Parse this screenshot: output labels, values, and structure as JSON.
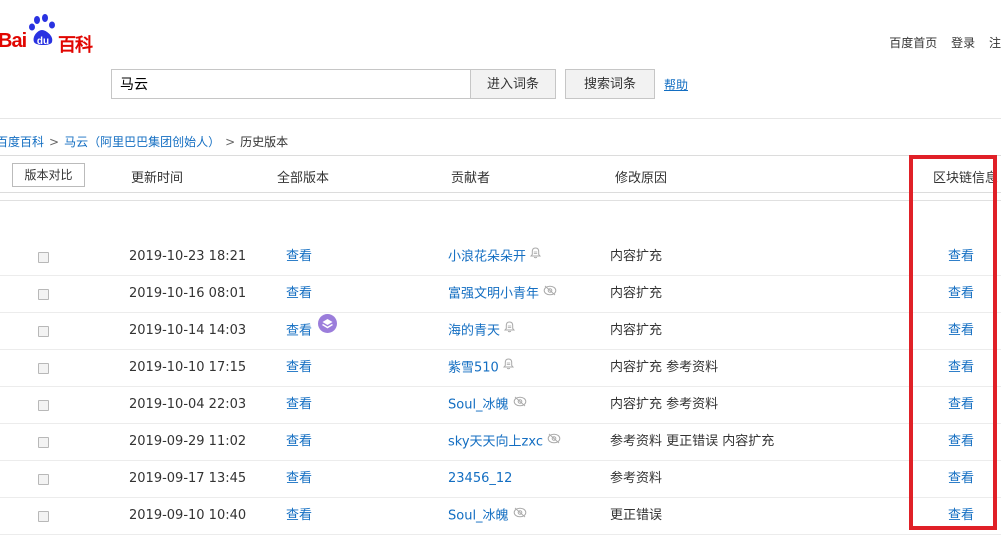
{
  "logo": {
    "bai": "Bai",
    "du": "du",
    "baike": "百科"
  },
  "top_links": [
    "百度首页",
    "登录",
    "注"
  ],
  "search": {
    "value": "马云",
    "enter_label": "进入词条",
    "search_label": "搜索词条",
    "help_label": "帮助"
  },
  "breadcrumb": {
    "home": "百度百科",
    "entry": "马云（阿里巴巴集团创始人）",
    "current": "历史版本",
    "separator": ">"
  },
  "table": {
    "compare_label": "版本对比",
    "columns": {
      "time": "更新时间",
      "all_versions": "全部版本",
      "contributor": "贡献者",
      "reason": "修改原因",
      "chain": "区块链信息"
    },
    "rows": [
      {
        "time": "2019-10-23 18:21",
        "view": "查看",
        "contributor": "小浪花朵朵开",
        "icon": "bell-icon",
        "reason": "内容扩充",
        "chain": "查看",
        "featured": false
      },
      {
        "time": "2019-10-16 08:01",
        "view": "查看",
        "contributor": "富强文明小青年",
        "icon": "eye-icon",
        "reason": "内容扩充",
        "chain": "查看",
        "featured": false
      },
      {
        "time": "2019-10-14 14:03",
        "view": "查看",
        "contributor": "海的青天",
        "icon": "bell-icon",
        "reason": "内容扩充",
        "chain": "查看",
        "featured": true
      },
      {
        "time": "2019-10-10 17:15",
        "view": "查看",
        "contributor": "紫雪510",
        "icon": "bell-icon",
        "reason": "内容扩充 参考资料",
        "chain": "查看",
        "featured": false
      },
      {
        "time": "2019-10-04 22:03",
        "view": "查看",
        "contributor": "Soul_冰魄",
        "icon": "eye-icon",
        "reason": "内容扩充 参考资料",
        "chain": "查看",
        "featured": false
      },
      {
        "time": "2019-09-29 11:02",
        "view": "查看",
        "contributor": "sky天天向上zxc",
        "icon": "eye-icon",
        "reason": "参考资料 更正错误 内容扩充",
        "chain": "查看",
        "featured": false
      },
      {
        "time": "2019-09-17 13:45",
        "view": "查看",
        "contributor": "23456_12",
        "icon": "",
        "reason": "参考资料",
        "chain": "查看",
        "featured": false
      },
      {
        "time": "2019-09-10 10:40",
        "view": "查看",
        "contributor": "Soul_冰魄",
        "icon": "eye-icon",
        "reason": "更正错误",
        "chain": "查看",
        "featured": false
      }
    ]
  },
  "colors": {
    "brand_red": "#e10601",
    "link_blue": "#136ec2",
    "highlight_red": "#e02027",
    "featured_purple": "#9b7ddb"
  }
}
